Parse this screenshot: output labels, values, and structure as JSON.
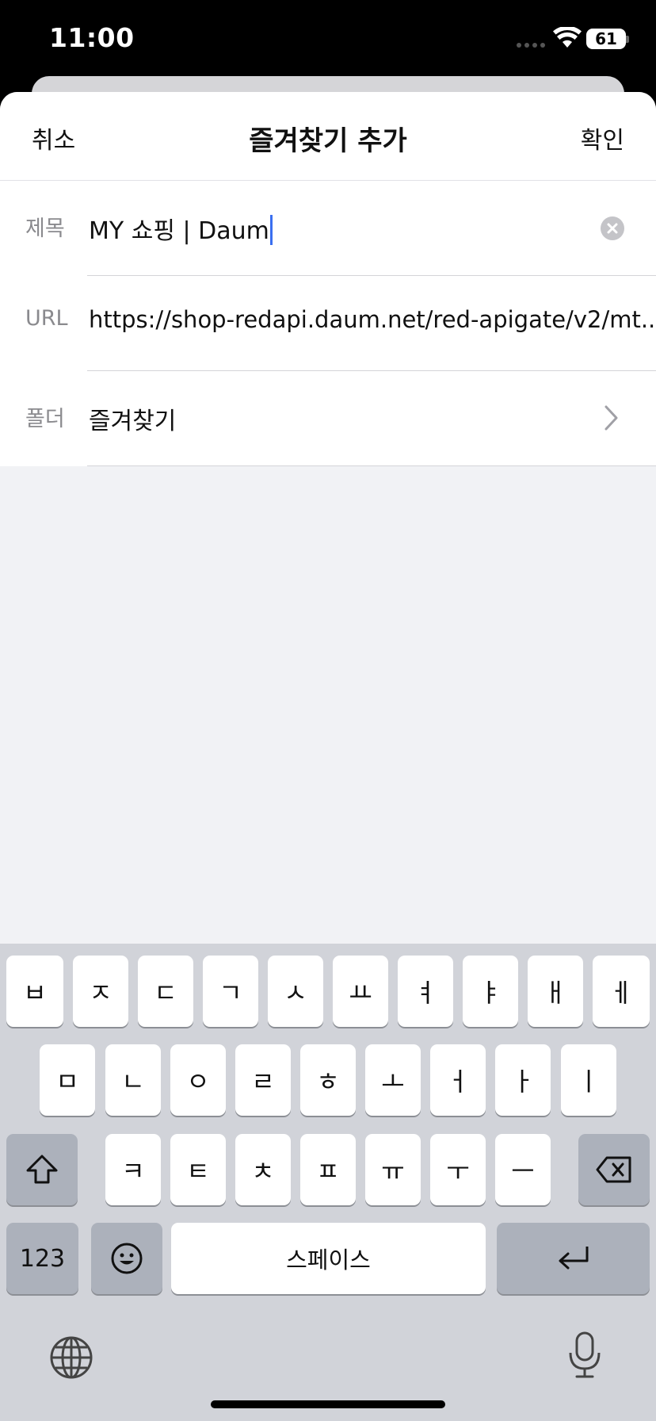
{
  "status_bar": {
    "time": "11:00",
    "battery": "61"
  },
  "nav": {
    "cancel": "취소",
    "title": "즐겨찾기 추가",
    "confirm": "확인"
  },
  "form": {
    "title_label": "제목",
    "title_value": "MY 쇼핑 | Daum",
    "url_label": "URL",
    "url_value": "https://shop-redapi.daum.net/red-apigate/v2/mt...",
    "folder_label": "폴더",
    "folder_value": "즐겨찾기"
  },
  "keyboard": {
    "row1": [
      "ㅂ",
      "ㅈ",
      "ㄷ",
      "ㄱ",
      "ㅅ",
      "ㅛ",
      "ㅕ",
      "ㅑ",
      "ㅐ",
      "ㅔ"
    ],
    "row2": [
      "ㅁ",
      "ㄴ",
      "ㅇ",
      "ㄹ",
      "ㅎ",
      "ㅗ",
      "ㅓ",
      "ㅏ",
      "ㅣ"
    ],
    "row3": [
      "ㅋ",
      "ㅌ",
      "ㅊ",
      "ㅍ",
      "ㅠ",
      "ㅜ",
      "ㅡ"
    ],
    "numbers_key": "123",
    "space_key": "스페이스",
    "icons": [
      "shift-icon",
      "backspace-icon",
      "emoji-icon",
      "return-icon",
      "globe-icon",
      "microphone-icon"
    ]
  },
  "colors": {
    "accent_caret": "#3a6ff0",
    "sheet_background": "#f1f2f5",
    "keyboard_background": "#d1d3d9"
  }
}
